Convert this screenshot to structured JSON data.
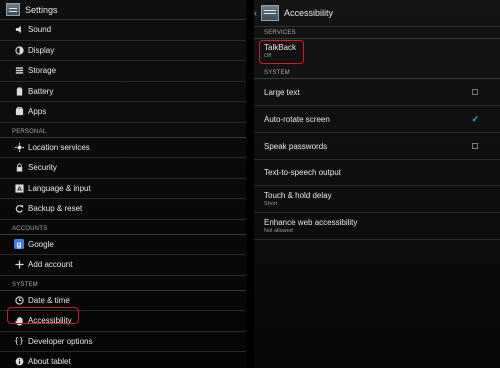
{
  "left": {
    "title": "Settings",
    "items_top": [
      {
        "label": "Sound",
        "icon": "speaker-icon"
      },
      {
        "label": "Display",
        "icon": "brightness-icon"
      },
      {
        "label": "Storage",
        "icon": "storage-icon"
      },
      {
        "label": "Battery",
        "icon": "battery-icon"
      },
      {
        "label": "Apps",
        "icon": "apps-icon"
      }
    ],
    "personal_header": "PERSONAL",
    "items_personal": [
      {
        "label": "Location services",
        "icon": "location-icon"
      },
      {
        "label": "Security",
        "icon": "lock-icon"
      },
      {
        "label": "Language & input",
        "icon": "keyboard-icon"
      },
      {
        "label": "Backup & reset",
        "icon": "backup-icon"
      }
    ],
    "accounts_header": "ACCOUNTS",
    "items_accounts": [
      {
        "label": "Google",
        "icon": "google-icon"
      },
      {
        "label": "Add account",
        "icon": "plus-icon"
      }
    ],
    "system_header": "SYSTEM",
    "items_system": [
      {
        "label": "Date & time",
        "icon": "clock-icon"
      },
      {
        "label": "Accessibility",
        "icon": "hand-icon"
      },
      {
        "label": "Developer options",
        "icon": "braces-icon"
      },
      {
        "label": "About tablet",
        "icon": "info-icon"
      }
    ]
  },
  "right": {
    "title": "Accessibility",
    "services_header": "SERVICES",
    "talkback": {
      "label": "TalkBack",
      "status": "Off"
    },
    "system_header": "SYSTEM",
    "large_text": {
      "label": "Large text",
      "checked": false
    },
    "auto_rotate": {
      "label": "Auto-rotate screen",
      "checked": true
    },
    "speak_passwords": {
      "label": "Speak passwords",
      "checked": false
    },
    "tts": {
      "label": "Text-to-speech output"
    },
    "touch_hold": {
      "label": "Touch & hold delay",
      "value": "Short"
    },
    "web_access": {
      "label": "Enhance web accessibility",
      "value": "Not allowed"
    }
  },
  "colors": {
    "accent": "#33b5e5",
    "highlight": "#cc1f2a"
  }
}
